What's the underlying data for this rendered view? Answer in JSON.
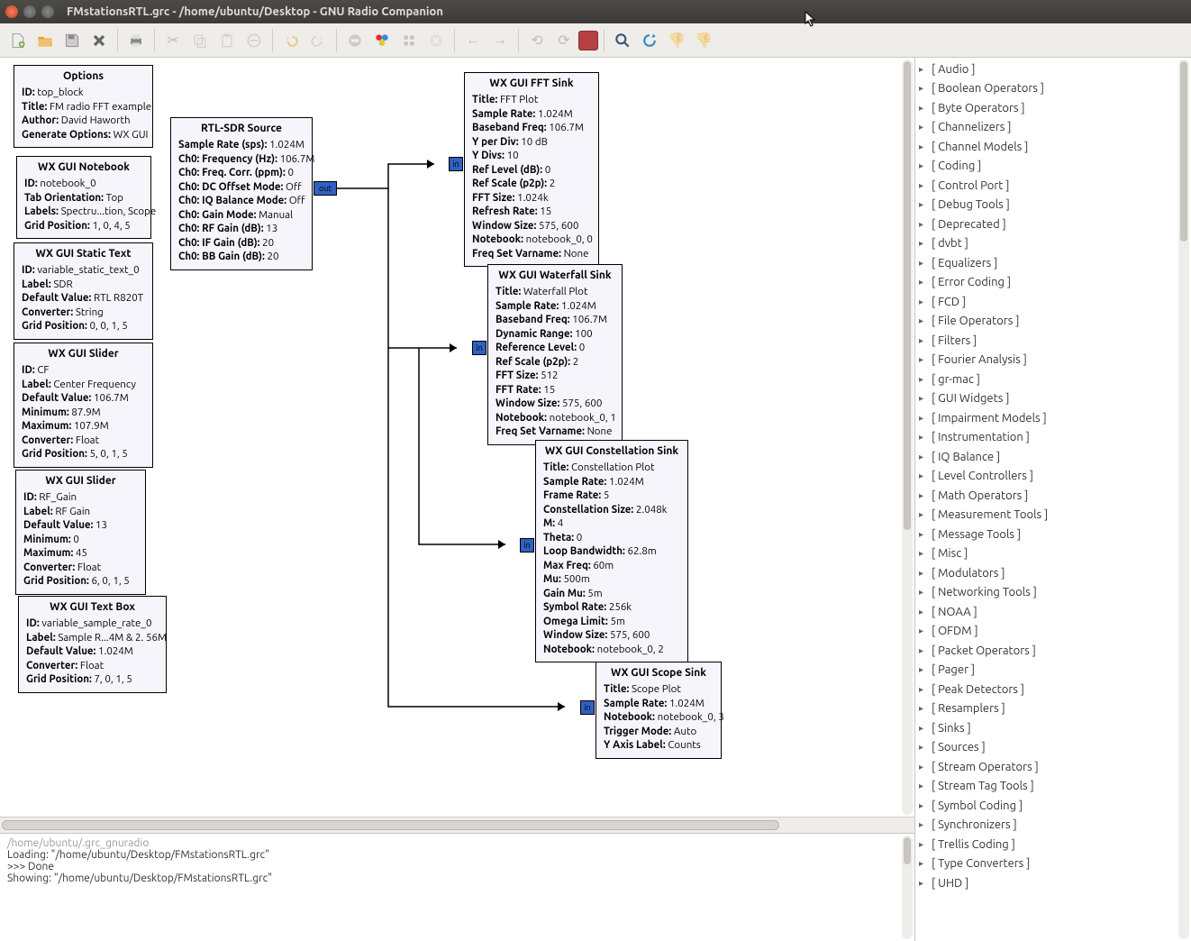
{
  "window": {
    "title": "FMstationsRTL.grc - /home/ubuntu/Desktop - GNU Radio Companion"
  },
  "console": {
    "line0": "/home/ubuntu/.grc_gnuradio",
    "line1": "",
    "line2": "Loading: \"/home/ubuntu/Desktop/FMstationsRTL.grc\"",
    "line3": ">>> Done",
    "line4": "",
    "line5": "Showing: \"/home/ubuntu/Desktop/FMstationsRTL.grc\""
  },
  "categories": [
    "[ Audio ]",
    "[ Boolean Operators ]",
    "[ Byte Operators ]",
    "[ Channelizers ]",
    "[ Channel Models ]",
    "[ Coding ]",
    "[ Control Port ]",
    "[ Debug Tools ]",
    "[ Deprecated ]",
    "[ dvbt ]",
    "[ Equalizers ]",
    "[ Error Coding ]",
    "[ FCD ]",
    "[ File Operators ]",
    "[ Filters ]",
    "[ Fourier Analysis ]",
    "[ gr-mac ]",
    "[ GUI Widgets ]",
    "[ Impairment Models ]",
    "[ Instrumentation ]",
    "[ IQ Balance ]",
    "[ Level Controllers ]",
    "[ Math Operators ]",
    "[ Measurement Tools ]",
    "[ Message Tools ]",
    "[ Misc ]",
    "[ Modulators ]",
    "[ Networking Tools ]",
    "[ NOAA ]",
    "[ OFDM ]",
    "[ Packet Operators ]",
    "[ Pager ]",
    "[ Peak Detectors ]",
    "[ Resamplers ]",
    "[ Sinks ]",
    "[ Sources ]",
    "[ Stream Operators ]",
    "[ Stream Tag Tools ]",
    "[ Symbol Coding ]",
    "[ Synchronizers ]",
    "[ Trellis Coding ]",
    "[ Type Converters ]",
    "[ UHD ]"
  ],
  "blocks": {
    "options": {
      "title": "Options",
      "rows": [
        [
          "ID:",
          "top_block"
        ],
        [
          "Title:",
          "FM radio FFT example"
        ],
        [
          "Author:",
          "David Haworth"
        ],
        [
          "Generate Options:",
          "WX GUI"
        ]
      ]
    },
    "notebook": {
      "title": "WX GUI Notebook",
      "rows": [
        [
          "ID:",
          "notebook_0"
        ],
        [
          "Tab Orientation:",
          "Top"
        ],
        [
          "Labels:",
          "Spectru...tion, Scope"
        ],
        [
          "Grid Position:",
          "1, 0, 4, 5"
        ]
      ]
    },
    "statictext": {
      "title": "WX GUI Static Text",
      "rows": [
        [
          "ID:",
          "variable_static_text_0"
        ],
        [
          "Label:",
          "SDR"
        ],
        [
          "Default Value:",
          "RTL R820T"
        ],
        [
          "Converter:",
          "String"
        ],
        [
          "Grid Position:",
          "0, 0, 1, 5"
        ]
      ]
    },
    "slider1": {
      "title": "WX GUI Slider",
      "rows": [
        [
          "ID:",
          "CF"
        ],
        [
          "Label:",
          "Center Frequency"
        ],
        [
          "Default Value:",
          "106.7M"
        ],
        [
          "Minimum:",
          "87.9M"
        ],
        [
          "Maximum:",
          "107.9M"
        ],
        [
          "Converter:",
          "Float"
        ],
        [
          "Grid Position:",
          "5, 0, 1, 5"
        ]
      ]
    },
    "slider2": {
      "title": "WX GUI Slider",
      "rows": [
        [
          "ID:",
          "RF_Gain"
        ],
        [
          "Label:",
          "RF Gain"
        ],
        [
          "Default Value:",
          "13"
        ],
        [
          "Minimum:",
          "0"
        ],
        [
          "Maximum:",
          "45"
        ],
        [
          "Converter:",
          "Float"
        ],
        [
          "Grid Position:",
          "6, 0, 1, 5"
        ]
      ]
    },
    "textbox": {
      "title": "WX GUI Text Box",
      "rows": [
        [
          "ID:",
          "variable_sample_rate_0"
        ],
        [
          "Label:",
          "Sample R...4M & 2. 56M"
        ],
        [
          "Default Value:",
          "1.024M"
        ],
        [
          "Converter:",
          "Float"
        ],
        [
          "Grid Position:",
          "7, 0, 1, 5"
        ]
      ]
    },
    "rtlsdr": {
      "title": "RTL-SDR Source",
      "rows": [
        [
          "Sample Rate (sps):",
          "1.024M"
        ],
        [
          "Ch0: Frequency (Hz):",
          "106.7M"
        ],
        [
          "Ch0: Freq. Corr. (ppm):",
          "0"
        ],
        [
          "Ch0: DC Offset Mode:",
          "Off"
        ],
        [
          "Ch0: IQ Balance Mode:",
          "Off"
        ],
        [
          "Ch0: Gain Mode:",
          "Manual"
        ],
        [
          "Ch0: RF Gain (dB):",
          "13"
        ],
        [
          "Ch0: IF Gain (dB):",
          "20"
        ],
        [
          "Ch0: BB Gain (dB):",
          "20"
        ]
      ]
    },
    "fft": {
      "title": "WX GUI FFT Sink",
      "rows": [
        [
          "Title:",
          "FFT Plot"
        ],
        [
          "Sample Rate:",
          "1.024M"
        ],
        [
          "Baseband Freq:",
          "106.7M"
        ],
        [
          "Y per Div:",
          "10 dB"
        ],
        [
          "Y Divs:",
          "10"
        ],
        [
          "Ref Level (dB):",
          "0"
        ],
        [
          "Ref Scale (p2p):",
          "2"
        ],
        [
          "FFT Size:",
          "1.024k"
        ],
        [
          "Refresh Rate:",
          "15"
        ],
        [
          "Window Size:",
          "575, 600"
        ],
        [
          "Notebook:",
          "notebook_0, 0"
        ],
        [
          "Freq Set Varname:",
          "None"
        ]
      ]
    },
    "waterfall": {
      "title": "WX GUI Waterfall Sink",
      "rows": [
        [
          "Title:",
          "Waterfall Plot"
        ],
        [
          "Sample Rate:",
          "1.024M"
        ],
        [
          "Baseband Freq:",
          "106.7M"
        ],
        [
          "Dynamic Range:",
          "100"
        ],
        [
          "Reference Level:",
          "0"
        ],
        [
          "Ref Scale (p2p):",
          "2"
        ],
        [
          "FFT Size:",
          "512"
        ],
        [
          "FFT Rate:",
          "15"
        ],
        [
          "Window Size:",
          "575, 600"
        ],
        [
          "Notebook:",
          "notebook_0, 1"
        ],
        [
          "Freq Set Varname:",
          "None"
        ]
      ]
    },
    "constel": {
      "title": "WX GUI Constellation Sink",
      "rows": [
        [
          "Title:",
          "Constellation Plot"
        ],
        [
          "Sample Rate:",
          "1.024M"
        ],
        [
          "Frame Rate:",
          "5"
        ],
        [
          "Constellation Size:",
          "2.048k"
        ],
        [
          "M:",
          "4"
        ],
        [
          "Theta:",
          "0"
        ],
        [
          "Loop Bandwidth:",
          "62.8m"
        ],
        [
          "Max Freq:",
          "60m"
        ],
        [
          "Mu:",
          "500m"
        ],
        [
          "Gain Mu:",
          "5m"
        ],
        [
          "Symbol Rate:",
          "256k"
        ],
        [
          "Omega Limit:",
          "5m"
        ],
        [
          "Window Size:",
          "575, 600"
        ],
        [
          "Notebook:",
          "notebook_0, 2"
        ]
      ]
    },
    "scope": {
      "title": "WX GUI Scope Sink",
      "rows": [
        [
          "Title:",
          "Scope Plot"
        ],
        [
          "Sample Rate:",
          "1.024M"
        ],
        [
          "Notebook:",
          "notebook_0, 3"
        ],
        [
          "Trigger Mode:",
          "Auto"
        ],
        [
          "Y Axis Label:",
          "Counts"
        ]
      ]
    }
  },
  "ports": {
    "in": "in",
    "out": "out"
  }
}
